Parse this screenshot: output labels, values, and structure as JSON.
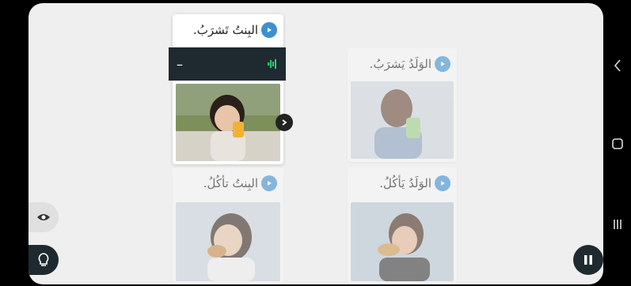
{
  "cards": [
    {
      "caption": "الوَلَدُ يَشرَبُ."
    },
    {
      "caption": "البِنتُ تَشرَبُ."
    },
    {
      "caption": "الوَلَدُ يَأكُلُ."
    },
    {
      "caption": "البِنتُ تأكُلُ."
    }
  ],
  "overlay": {
    "minus_label": "–"
  },
  "icons": {
    "speaker": "speaker-icon",
    "audio": "audio-wave-icon",
    "next": "chevron-right-icon",
    "eye": "eye-icon",
    "hint": "lightbulb-icon",
    "pause": "pause-icon"
  },
  "colors": {
    "accent": "#3d8fd3",
    "overlay": "#1f2a30",
    "wave": "#2ecc71"
  }
}
